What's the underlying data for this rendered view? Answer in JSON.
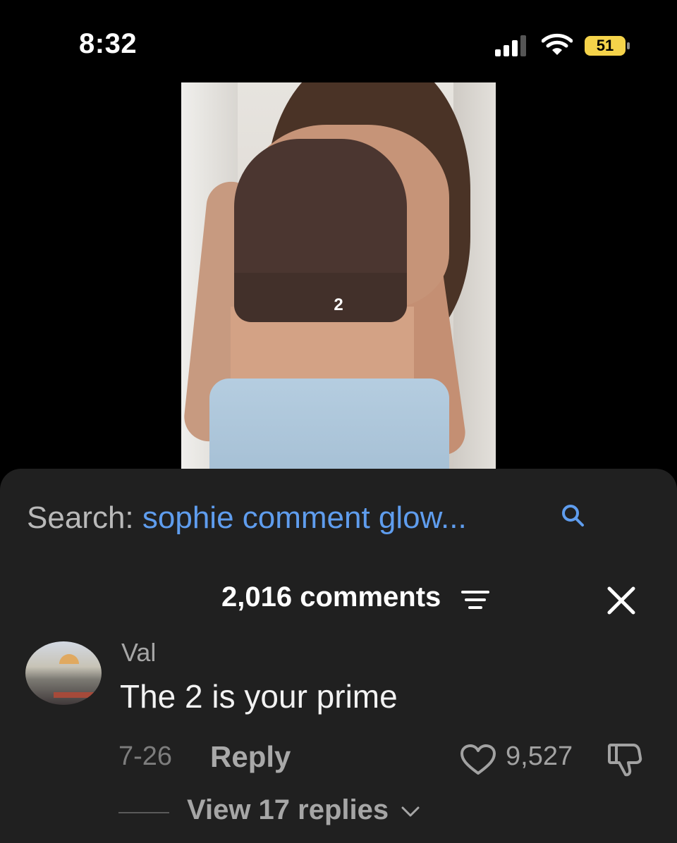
{
  "status_bar": {
    "time": "8:32",
    "battery_percent": "51",
    "battery_color": "#f5d34a",
    "signal_bars": 3,
    "icons": [
      "signal-icon",
      "wifi-icon",
      "battery-icon"
    ]
  },
  "video": {
    "overlay_label": "2"
  },
  "search": {
    "prefix": "Search:",
    "query": "sophie comment glow...",
    "query_color": "#5f9dee",
    "icon": "search-icon"
  },
  "comments_header": {
    "count_label": "2,016 comments",
    "filter_icon": "filter-icon",
    "close_icon": "close-icon"
  },
  "comment": {
    "author": "Val",
    "text": "The 2 is your prime",
    "date": "7-26",
    "reply_label": "Reply",
    "likes": "9,527",
    "view_replies": "View 17 replies",
    "icons": [
      "heart-icon",
      "dislike-icon",
      "chevron-down-icon"
    ]
  }
}
